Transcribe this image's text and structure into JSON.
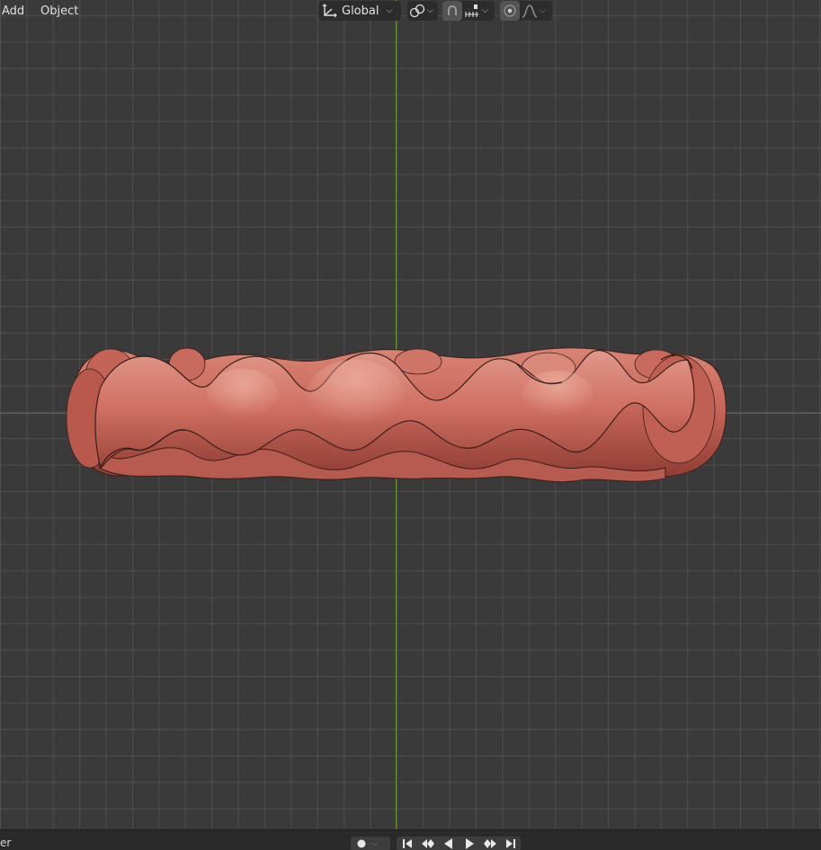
{
  "header": {
    "menus": [
      "Add",
      "Object"
    ],
    "orientation": {
      "icon": "transform-orientation-icon",
      "value": "Global"
    },
    "pivot_icon": "pivot-point-icon",
    "snap_icon": "snap-magnet-icon",
    "snap_increment_icon": "snap-increment-icon",
    "proportional_icon": "proportional-editing-icon",
    "falloff_icon": "falloff-curve-icon"
  },
  "viewport": {
    "background": "#3a3a3a",
    "x_axis_color": "#a44547",
    "y_axis_color": "#6b9732",
    "mesh_color": "#c96a5e"
  },
  "timeline": {
    "label": "er",
    "keyframe_icon": "record-keyframe-icon",
    "playback_icons": [
      "jump-to-start-icon",
      "jump-to-previous-keyframe-icon",
      "play-reverse-icon",
      "play-icon",
      "jump-to-next-keyframe-icon",
      "jump-to-end-icon"
    ]
  }
}
